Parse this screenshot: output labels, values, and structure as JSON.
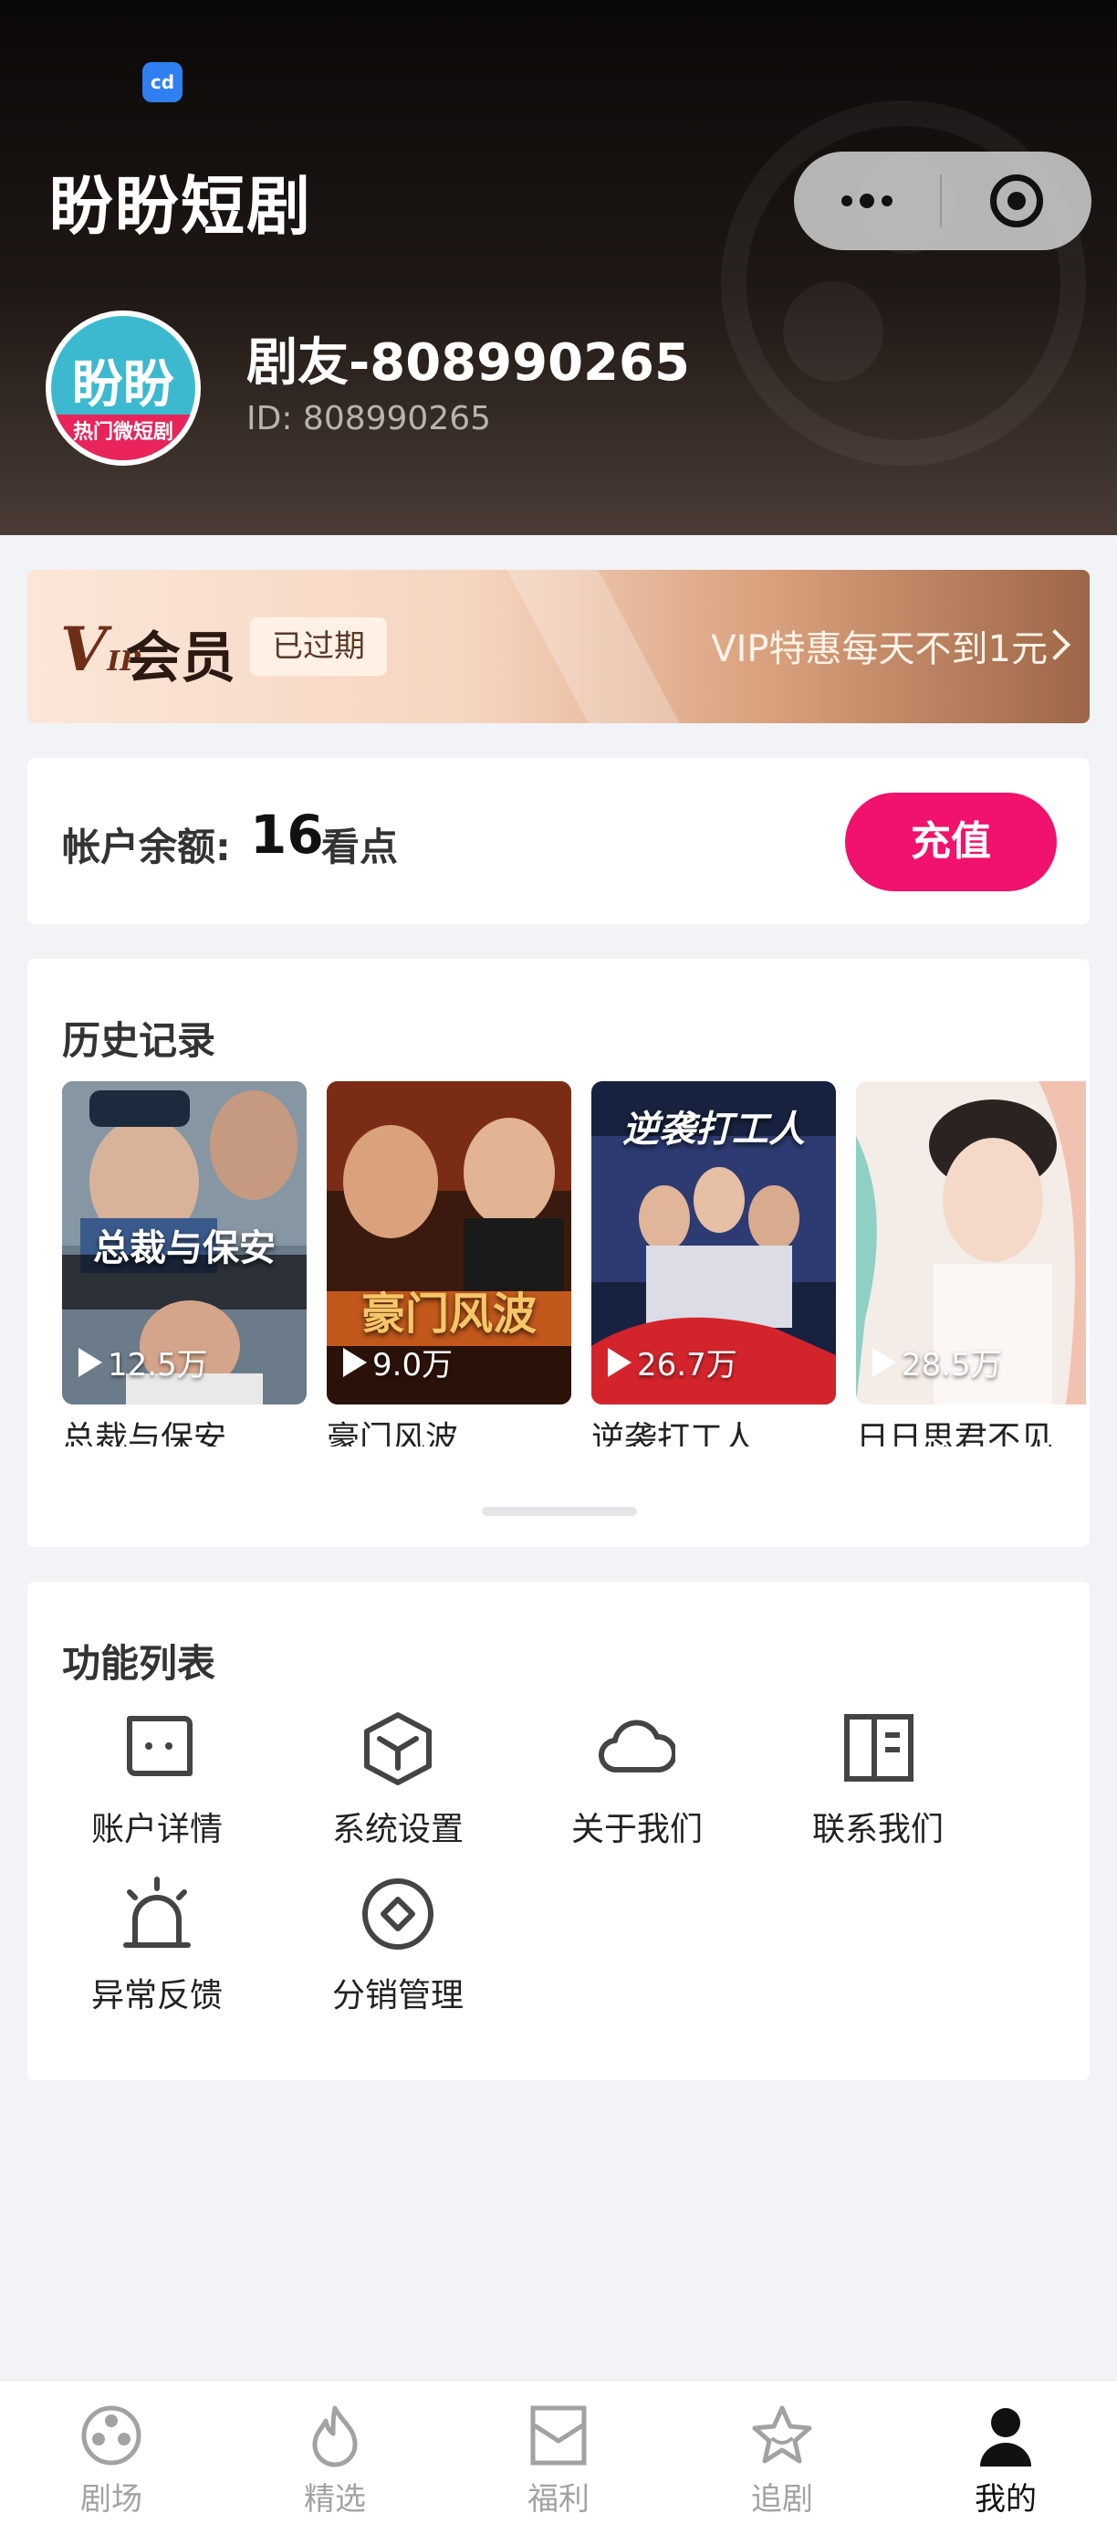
{
  "header": {
    "app_title": "盼盼短剧",
    "status_logo": "cd"
  },
  "profile": {
    "avatar_top": "盼盼",
    "avatar_bottom": "热门微短剧",
    "username": "剧友-808990265",
    "user_id": "ID:  808990265"
  },
  "vip": {
    "logo": "V",
    "logo_small": "IP",
    "title": "会员",
    "status": "已过期",
    "promo": "VIP特惠每天不到1元"
  },
  "balance": {
    "label": "帐户余额:",
    "value": "16",
    "unit": "看点",
    "recharge_label": "充值"
  },
  "history": {
    "title": "历史记录",
    "items": [
      {
        "name": "总裁与保安",
        "plays": "12.5万",
        "art_text": "总裁与保安"
      },
      {
        "name": "豪门风波",
        "plays": "9.0万",
        "art_text": "豪门风波"
      },
      {
        "name": "逆袭打工人",
        "plays": "26.7万",
        "art_text": "逆袭打工人"
      },
      {
        "name": "日日思君不见",
        "plays": "28.5万",
        "art_text": ""
      }
    ]
  },
  "functions": {
    "title": "功能列表",
    "items": [
      {
        "label": "账户详情",
        "icon": "chat-face-icon"
      },
      {
        "label": "系统设置",
        "icon": "cube-icon"
      },
      {
        "label": "关于我们",
        "icon": "cloud-icon"
      },
      {
        "label": "联系我们",
        "icon": "book-icon"
      },
      {
        "label": "异常反馈",
        "icon": "alarm-icon"
      },
      {
        "label": "分销管理",
        "icon": "diamond-circle-icon"
      }
    ]
  },
  "tabbar": {
    "items": [
      {
        "label": "剧场",
        "icon": "film-reel-icon",
        "active": false
      },
      {
        "label": "精选",
        "icon": "flame-icon",
        "active": false
      },
      {
        "label": "福利",
        "icon": "envelope-icon",
        "active": false
      },
      {
        "label": "追剧",
        "icon": "star-icon",
        "active": false
      },
      {
        "label": "我的",
        "icon": "person-icon",
        "active": true
      }
    ]
  },
  "colors": {
    "accent": "#f0126c",
    "tab_active": "#111111",
    "tab_inactive": "#a2a2a2"
  }
}
